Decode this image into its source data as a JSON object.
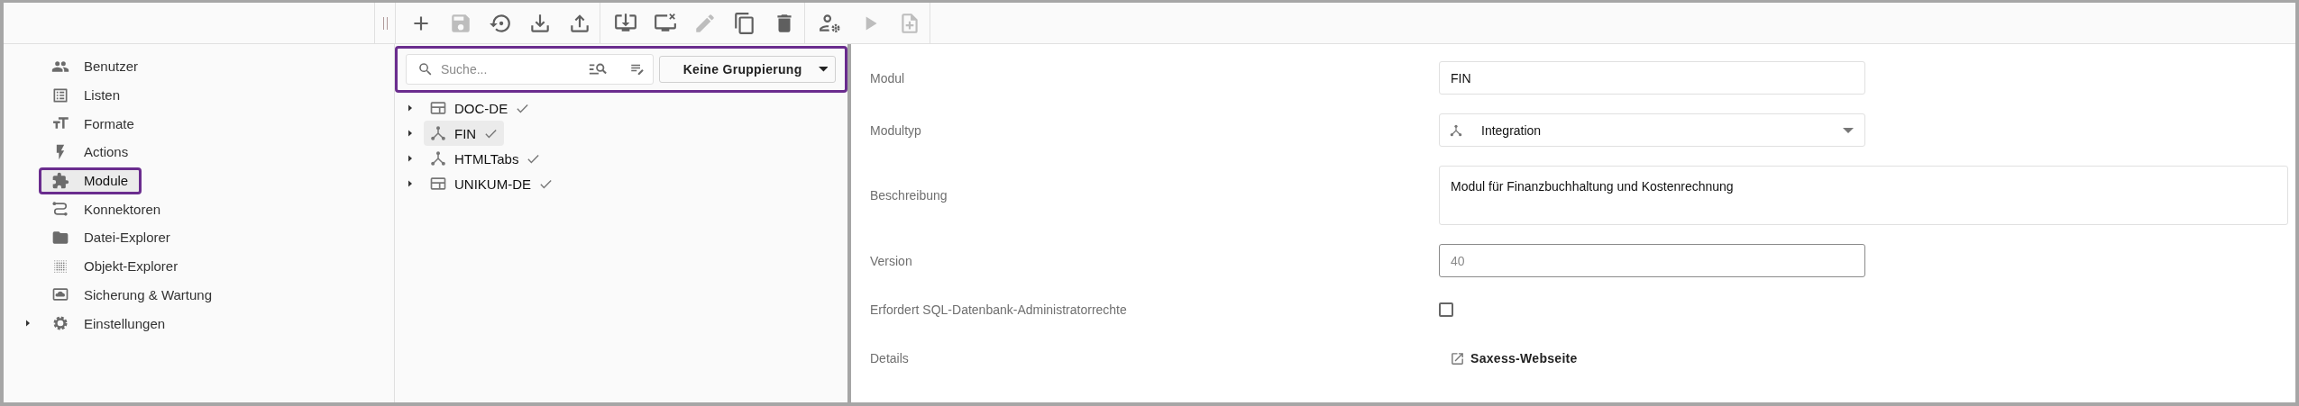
{
  "toolbar": {
    "groups": [
      [
        {
          "disabled": false
        },
        {
          "disabled": true
        },
        {
          "disabled": false
        },
        {
          "disabled": false
        },
        {
          "disabled": false
        }
      ],
      [
        {
          "disabled": false
        },
        {
          "disabled": false
        },
        {
          "disabled": true
        },
        {
          "disabled": false
        },
        {
          "disabled": false
        }
      ],
      [
        {
          "disabled": false
        },
        {
          "disabled": true
        },
        {
          "disabled": true
        }
      ]
    ]
  },
  "sidebar": {
    "items": [
      {
        "label": "Benutzer",
        "selected": false,
        "highlighted": false,
        "expandable": false
      },
      {
        "label": "Listen",
        "selected": false,
        "highlighted": false,
        "expandable": false
      },
      {
        "label": "Formate",
        "selected": false,
        "highlighted": false,
        "expandable": false
      },
      {
        "label": "Actions",
        "selected": false,
        "highlighted": false,
        "expandable": false
      },
      {
        "label": "Module",
        "selected": true,
        "highlighted": true,
        "expandable": false
      },
      {
        "label": "Konnektoren",
        "selected": false,
        "highlighted": false,
        "expandable": false
      },
      {
        "label": "Datei-Explorer",
        "selected": false,
        "highlighted": false,
        "expandable": false
      },
      {
        "label": "Objekt-Explorer",
        "selected": false,
        "highlighted": false,
        "expandable": false
      },
      {
        "label": "Sicherung & Wartung",
        "selected": false,
        "highlighted": false,
        "expandable": false
      },
      {
        "label": "Einstellungen",
        "selected": false,
        "highlighted": false,
        "expandable": true
      }
    ]
  },
  "tree": {
    "highlighted": true,
    "search": {
      "placeholder": "Suche..."
    },
    "grouping": "Keine Gruppierung",
    "nodes": [
      {
        "label": "DOC-DE",
        "kind": "layout",
        "valid": true,
        "selected": false
      },
      {
        "label": "FIN",
        "kind": "integration",
        "valid": true,
        "selected": true
      },
      {
        "label": "HTMLTabs",
        "kind": "integration",
        "valid": true,
        "selected": false
      },
      {
        "label": "UNIKUM-DE",
        "kind": "layout",
        "valid": true,
        "selected": false
      }
    ]
  },
  "form": {
    "fields": [
      {
        "kind": "text",
        "label": "Modul",
        "value": "FIN",
        "readonly": false
      },
      {
        "kind": "select",
        "label": "Modultyp",
        "value": "Integration"
      },
      {
        "kind": "textarea",
        "label": "Beschreibung",
        "value": "Modul für Finanzbuchhaltung und Kostenrechnung"
      },
      {
        "kind": "text",
        "label": "Version",
        "value": "40",
        "readonly": true
      },
      {
        "kind": "checkbox",
        "label": "Erfordert SQL-Datenbank-Administratorrechte",
        "checked": false
      },
      {
        "kind": "link",
        "label": "Details",
        "value": "Saxess-Webseite"
      }
    ]
  }
}
